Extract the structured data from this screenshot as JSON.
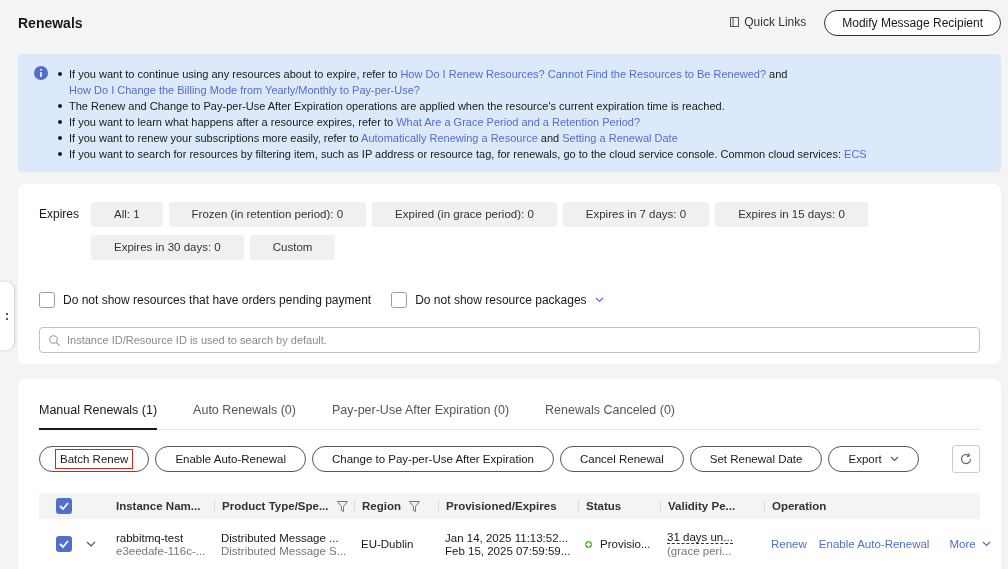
{
  "header": {
    "title": "Renewals",
    "quick_links": "Quick Links",
    "modify_button": "Modify Message Recipient"
  },
  "notice": {
    "items": [
      {
        "parts": [
          {
            "text": "If you want to continue using any resources about to expire, refer to ",
            "link": false
          },
          {
            "text": "How Do I Renew Resources? Cannot Find the Resources to Be Renewed?",
            "link": true
          },
          {
            "text": " and ",
            "link": false
          },
          {
            "text": "How Do I Change the Billing Mode from Yearly/Monthly to Pay-per-Use?",
            "link": true
          }
        ]
      },
      {
        "parts": [
          {
            "text": "The Renew and Change to Pay-per-Use After Expiration operations are applied when the resource's current expiration time is reached.",
            "link": false
          }
        ]
      },
      {
        "parts": [
          {
            "text": "If you want to learn what happens after a resource expires, refer to ",
            "link": false
          },
          {
            "text": "What Are a Grace Period and a Retention Period?",
            "link": true
          }
        ]
      },
      {
        "parts": [
          {
            "text": "If you want to renew your subscriptions more easily, refer to ",
            "link": false
          },
          {
            "text": "Automatically Renewing a Resource",
            "link": true
          },
          {
            "text": " and ",
            "link": false
          },
          {
            "text": "Setting a Renewal Date",
            "link": true
          }
        ]
      },
      {
        "parts": [
          {
            "text": "If you want to search for resources by filtering item, such as IP address or resource tag, for renewals, go to the cloud service console. Common cloud services: ",
            "link": false
          },
          {
            "text": "ECS",
            "link": true
          }
        ]
      }
    ]
  },
  "filters": {
    "label": "Expires",
    "options": [
      "All: 1",
      "Frozen (in retention period): 0",
      "Expired (in grace period): 0",
      "Expires in 7 days: 0",
      "Expires in 15 days: 0",
      "Expires in 30 days: 0",
      "Custom"
    ],
    "checkboxes": [
      {
        "label": "Do not show resources that have orders pending payment",
        "checked": false,
        "has_menu": false
      },
      {
        "label": "Do not show resource packages",
        "checked": false,
        "has_menu": true
      }
    ],
    "search": {
      "placeholder": "Instance ID/Resource ID is used to search by default."
    }
  },
  "tabs": [
    {
      "label": "Manual Renewals (1)",
      "selected": true
    },
    {
      "label": "Auto Renewals (0)",
      "selected": false
    },
    {
      "label": "Pay-per-Use After Expiration (0)",
      "selected": false
    },
    {
      "label": "Renewals Canceled (0)",
      "selected": false
    }
  ],
  "actions": [
    {
      "label": "Batch Renew",
      "focused": true,
      "kind": "button"
    },
    {
      "label": "Enable Auto-Renewal",
      "focused": false,
      "kind": "button"
    },
    {
      "label": "Change to Pay-per-Use After Expiration",
      "focused": false,
      "kind": "button"
    },
    {
      "label": "Cancel Renewal",
      "focused": false,
      "kind": "button"
    },
    {
      "label": "Set Renewal Date",
      "focused": false,
      "kind": "button"
    },
    {
      "label": "Export",
      "focused": false,
      "kind": "dropdown"
    }
  ],
  "table": {
    "select_all_checked": true,
    "columns": [
      {
        "label": "Instance Nam...",
        "filter": false
      },
      {
        "label": "Product Type/Spe...",
        "filter": true
      },
      {
        "label": "Region",
        "filter": true
      },
      {
        "label": "Provisioned/Expires",
        "filter": false
      },
      {
        "label": "Status",
        "filter": false
      },
      {
        "label": "Validity Pe...",
        "filter": false
      },
      {
        "label": "Operation",
        "filter": false
      }
    ],
    "rows": [
      {
        "checked": true,
        "expanded": false,
        "instance_name": "rabbitmq-test",
        "instance_id": "e3eedafe-116c-...",
        "product_type": "Distributed Message ...",
        "product_spec": "Distributed Message S...",
        "region": "EU-Dublin",
        "provisioned": "Jan 14, 2025 11:13:52...",
        "expires": "Feb 15, 2025 07:59:59...",
        "status": "Provisio...",
        "color": "#52c41a",
        "validity": "31 days un...",
        "validity_note": "(grace peri...",
        "operations": [
          "Renew",
          "Enable Auto-Renewal",
          "More"
        ]
      }
    ]
  }
}
